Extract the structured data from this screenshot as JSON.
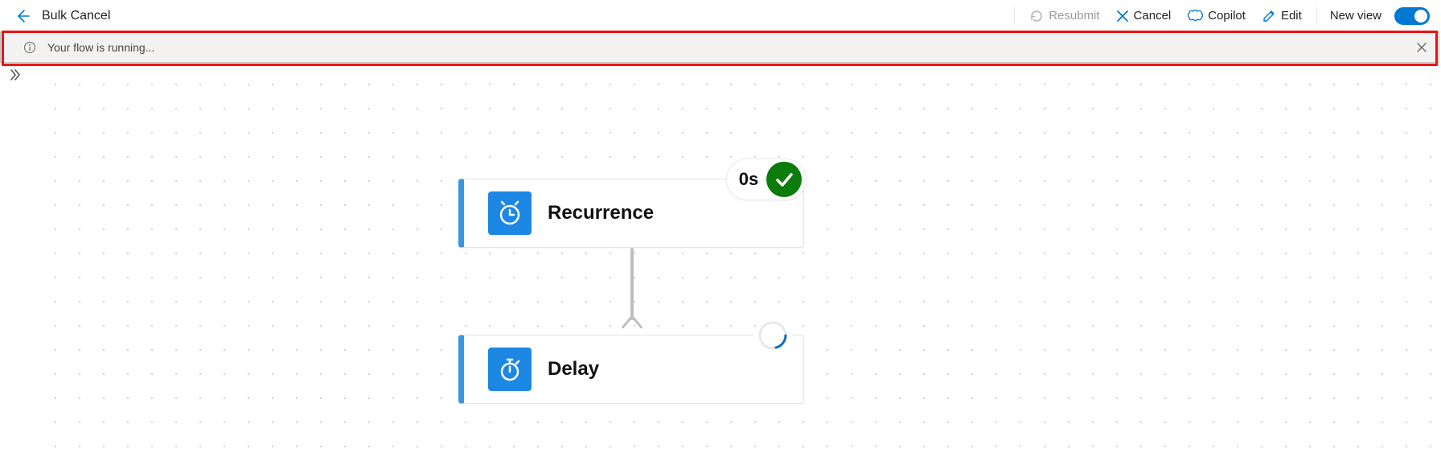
{
  "header": {
    "title": "Bulk Cancel",
    "actions": {
      "resubmit": "Resubmit",
      "cancel": "Cancel",
      "copilot": "Copilot",
      "edit": "Edit",
      "new_view": "New view"
    },
    "toggle_on": true
  },
  "banner": {
    "message": "Your flow is running..."
  },
  "nodes": [
    {
      "id": "recurrence",
      "label": "Recurrence",
      "icon": "clock-recurrence-icon",
      "status": "success",
      "duration": "0s"
    },
    {
      "id": "delay",
      "label": "Delay",
      "icon": "stopwatch-icon",
      "status": "running"
    }
  ]
}
